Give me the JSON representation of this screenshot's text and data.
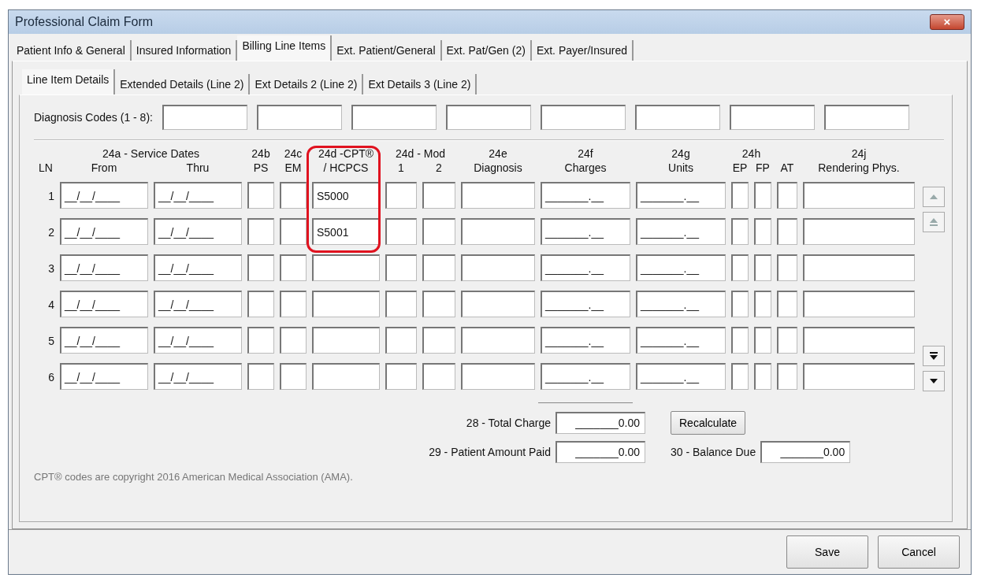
{
  "window": {
    "title": "Professional Claim Form",
    "close": "×"
  },
  "tabs": [
    {
      "label": "Patient Info & General",
      "selected": false
    },
    {
      "label": "Insured Information",
      "selected": false
    },
    {
      "label": "Billing Line Items",
      "selected": true
    },
    {
      "label": "Ext. Patient/General",
      "selected": false
    },
    {
      "label": "Ext. Pat/Gen (2)",
      "selected": false
    },
    {
      "label": "Ext. Payer/Insured",
      "selected": false
    }
  ],
  "subtabs": [
    {
      "label": "Line Item Details",
      "selected": true
    },
    {
      "label": "Extended Details (Line 2)",
      "selected": false
    },
    {
      "label": "Ext Details 2 (Line 2)",
      "selected": false
    },
    {
      "label": "Ext Details 3 (Line 2)",
      "selected": false
    }
  ],
  "diagnosis_codes": {
    "label": "Diagnosis Codes (1 - 8):",
    "fields": [
      {
        "kind": "text"
      },
      {
        "kind": "text"
      },
      {
        "kind": "text"
      },
      {
        "kind": "text"
      },
      {
        "kind": "text"
      },
      {
        "kind": "text"
      },
      {
        "kind": "text"
      },
      {
        "kind": "text"
      }
    ]
  },
  "column_headers": [
    {
      "subs": [
        "LN"
      ]
    },
    {
      "title": "24a - Service Dates",
      "subs": [
        "From",
        "Thru"
      ]
    },
    {
      "title": "24b",
      "subs": [
        "PS"
      ]
    },
    {
      "title": "24c",
      "subs": [
        "EM"
      ]
    },
    {
      "title": "24d -CPT®",
      "subs": [
        "/ HCPCS"
      ],
      "highlighted": true
    },
    {
      "title": "24d - Mod",
      "subs": [
        "1",
        "2"
      ]
    },
    {
      "title": "24e",
      "subs": [
        "Diagnosis"
      ]
    },
    {
      "title": "24f",
      "subs": [
        "Charges"
      ]
    },
    {
      "title": "24g",
      "subs": [
        "Units"
      ]
    },
    {
      "title": "24h",
      "subs": [
        "EP",
        "FP"
      ]
    },
    {
      "subs": [
        "AT"
      ]
    },
    {
      "title": "24j",
      "subs": [
        "Rendering Phys."
      ]
    }
  ],
  "rows": [
    {
      "ln": "1",
      "from": "__/__/____",
      "thru": "__/__/____",
      "cpt": "S5000",
      "charges": "_______.__",
      "units": "_______.__"
    },
    {
      "ln": "2",
      "from": "__/__/____",
      "thru": "__/__/____",
      "cpt": "S5001",
      "charges": "_______.__",
      "units": "_______.__"
    },
    {
      "ln": "3",
      "from": "__/__/____",
      "thru": "__/__/____",
      "charges": "_______.__",
      "units": "_______.__"
    },
    {
      "ln": "4",
      "from": "__/__/____",
      "thru": "__/__/____",
      "charges": "_______.__",
      "units": "_______.__"
    },
    {
      "ln": "5",
      "from": "__/__/____",
      "thru": "__/__/____",
      "charges": "_______.__",
      "units": "_______.__"
    },
    {
      "ln": "6",
      "from": "__/__/____",
      "thru": "__/__/____",
      "charges": "_______.__",
      "units": "_______.__"
    }
  ],
  "totals": {
    "total_charge": {
      "label": "28 - Total Charge",
      "value": "_______0.00"
    },
    "recalculate": "Recalculate",
    "patient_amount_paid": {
      "label": "29 - Patient Amount Paid",
      "value": "_______0.00"
    },
    "balance_due": {
      "label": "30 - Balance Due",
      "value": "_______0.00"
    }
  },
  "footnote": "CPT® codes are copyright 2016 American Medical Association (AMA).",
  "buttons": [
    "Save",
    "Cancel"
  ]
}
